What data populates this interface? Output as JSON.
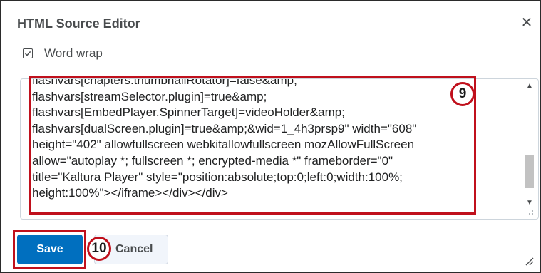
{
  "dialog": {
    "title": "HTML Source Editor",
    "close_icon": "close-icon"
  },
  "options": {
    "word_wrap_label": "Word wrap",
    "word_wrap_checked": true
  },
  "editor": {
    "content": "flashvars[chapters.thumbnailRotator]=false&amp;\nflashvars[streamSelector.plugin]=true&amp;\nflashvars[EmbedPlayer.SpinnerTarget]=videoHolder&amp;\nflashvars[dualScreen.plugin]=true&amp;&wid=1_4h3prsp9\" width=\"608\"\nheight=\"402\" allowfullscreen webkitallowfullscreen mozAllowFullScreen\nallow=\"autoplay *; fullscreen *; encrypted-media *\" frameborder=\"0\"\ntitle=\"Kaltura Player\" style=\"position:absolute;top:0;left:0;width:100%;\nheight:100%\"></iframe></div></div>"
  },
  "annotations": {
    "step9": "9",
    "step10": "10"
  },
  "buttons": {
    "save": "Save",
    "cancel": "Cancel"
  },
  "colors": {
    "primary": "#006fbf",
    "annotation": "#c0101c"
  }
}
